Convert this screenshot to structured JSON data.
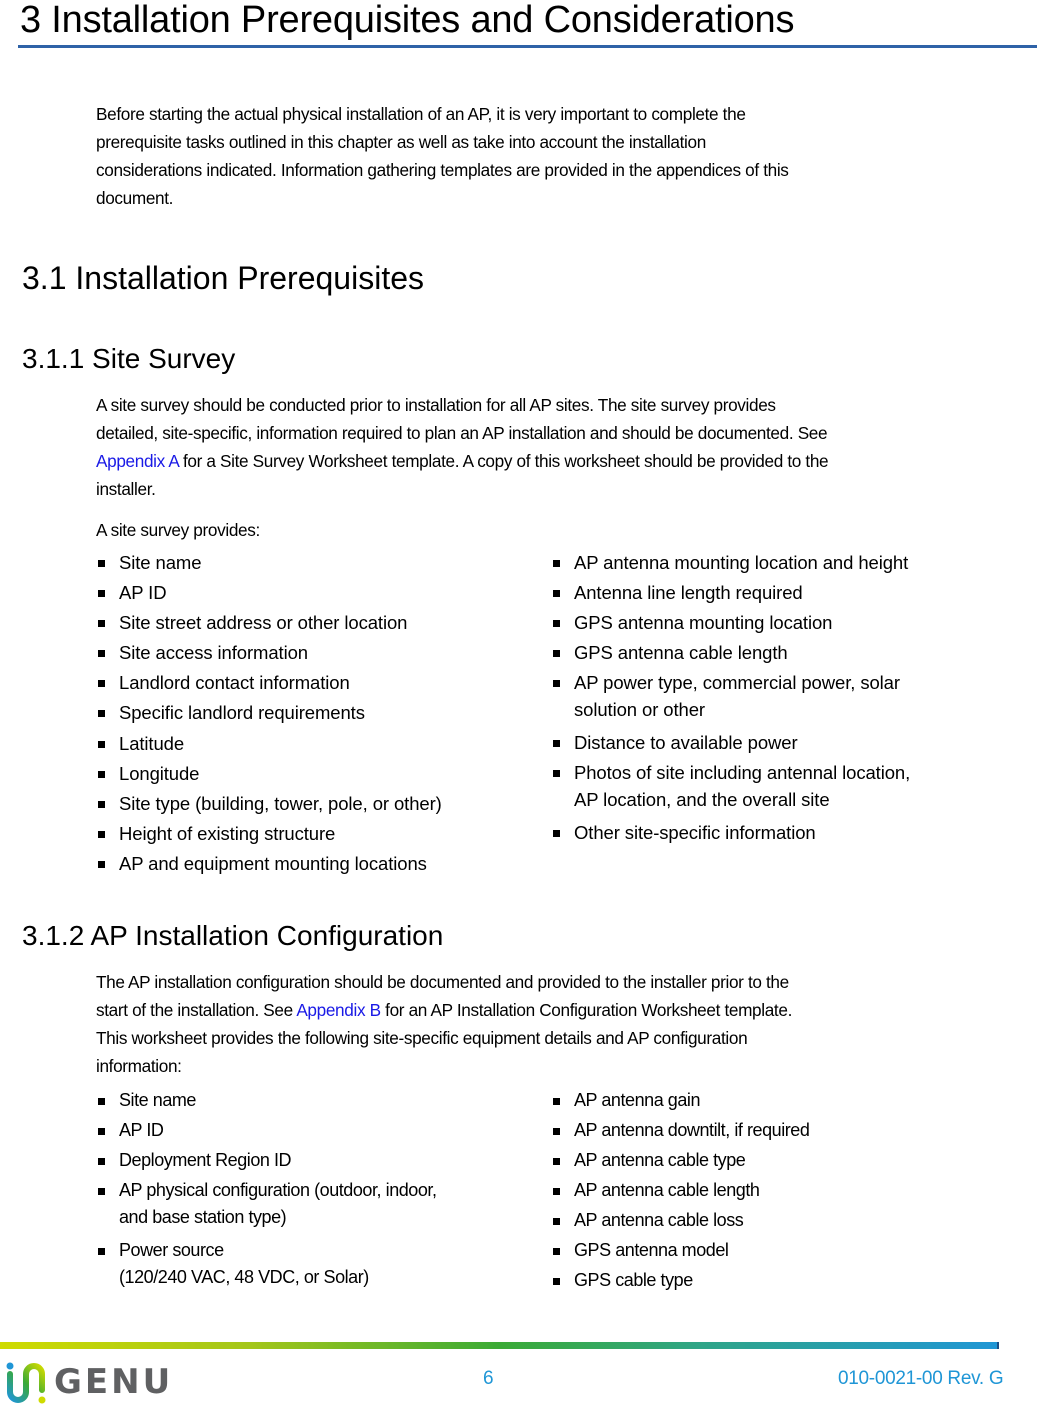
{
  "heading1": "3 Installation Prerequisites and Considerations",
  "intro": [
    "Before starting the actual physical installation of an AP, it is very important to complete the",
    "prerequisite tasks outlined in this chapter as well as take into account the installation",
    "considerations indicated. Information gathering templates are provided in the appendices of this",
    "document."
  ],
  "section_3_1": {
    "title": "3.1 Installation Prerequisites"
  },
  "section_3_1_1": {
    "title": "3.1.1 Site Survey",
    "paragraph": {
      "line1": "A site survey should be conducted prior to installation for all AP sites. The site survey provides",
      "line2": "detailed, site-specific, information required to plan an AP installation and should be documented. See",
      "line3_link": "Appendix A",
      "line3_rest": " for a Site Survey Worksheet template. A copy of this worksheet should be provided to the",
      "line4": "installer."
    },
    "lead": "A site survey provides:",
    "list_left": [
      "Site name",
      "AP ID",
      "Site street address or other location",
      "Site access information",
      "Landlord contact information",
      "Specific landlord requirements",
      "Latitude",
      "Longitude",
      "Site type (building, tower, pole, or other)",
      "Height of existing structure",
      "AP and equipment mounting locations"
    ],
    "list_right": [
      [
        "AP antenna mounting location and height"
      ],
      [
        "Antenna line length required"
      ],
      [
        "GPS antenna mounting location"
      ],
      [
        "GPS antenna cable length"
      ],
      [
        "AP power type, commercial power, solar",
        "solution or other"
      ],
      [
        "Distance to available power"
      ],
      [
        "Photos of site including antennal location,",
        "AP location, and the overall site"
      ],
      [
        "Other site-specific  information"
      ]
    ]
  },
  "section_3_1_2": {
    "title": "3.1.2 AP Installation Configuration",
    "paragraph": {
      "line1": "The AP installation configuration should be documented and provided to the installer prior to the",
      "line2_pre": "start of the installation. See ",
      "line2_link": "Appendix B",
      "line2_rest": " for an AP Installation Configuration Worksheet template.",
      "line3": "This worksheet provides the following site-specific equipment details and AP configuration",
      "line4": "information:"
    },
    "list_left": [
      [
        "Site name"
      ],
      [
        "AP ID"
      ],
      [
        "Deployment Region ID"
      ],
      [
        "AP physical configuration (outdoor, indoor,",
        "and base station type)"
      ],
      [
        "Power source",
        "(120/240 VAC, 48 VDC, or Solar)"
      ]
    ],
    "list_right": [
      "AP antenna gain",
      "AP antenna downtilt, if required",
      "AP antenna cable type",
      "AP antenna cable length",
      "AP antenna cable loss",
      "GPS antenna model",
      "GPS cable type"
    ]
  },
  "footer": {
    "logo_text": "INGENU",
    "page_number": "6",
    "doc_id": "010-0021-00 Rev. G"
  },
  "colors": {
    "heading_rule": "#2e62a7",
    "link": "#1a1ae6",
    "footer_text": "#1f96d6",
    "logo_gray": "#5f6062"
  }
}
